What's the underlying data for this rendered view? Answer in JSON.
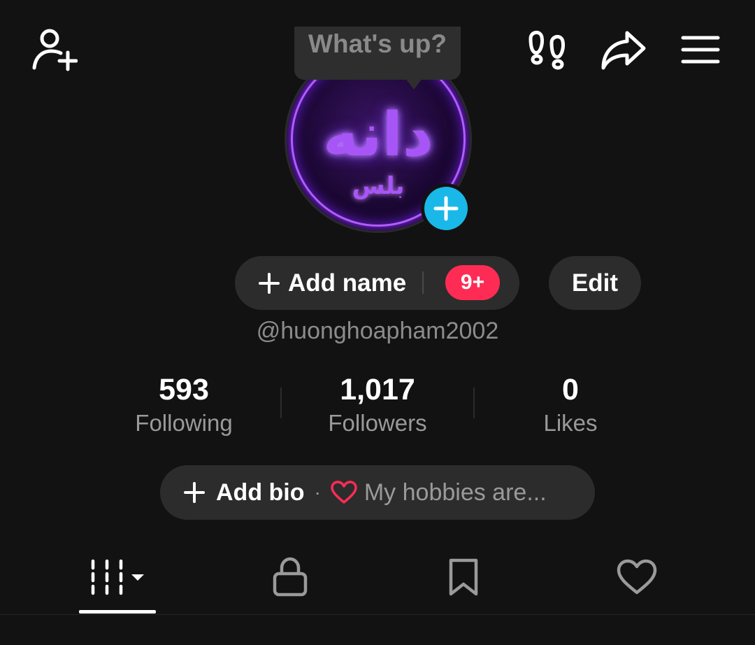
{
  "header": {
    "add_friend_icon": "person-plus-icon",
    "footprints_icon": "footprints-icon",
    "share_icon": "share-arrow-icon",
    "menu_icon": "hamburger-menu-icon"
  },
  "tooltip": {
    "text": "What's up?"
  },
  "avatar": {
    "logo_text": "دانه",
    "logo_sub": "بلس",
    "add_icon": "plus-icon",
    "add_color": "#1ab8e8"
  },
  "profile": {
    "add_name_label": "Add name",
    "badge": "9+",
    "badge_color": "#fe2c55",
    "edit_label": "Edit",
    "username": "@huonghoapham2002"
  },
  "stats": [
    {
      "value": "593",
      "label": "Following"
    },
    {
      "value": "1,017",
      "label": "Followers"
    },
    {
      "value": "0",
      "label": "Likes"
    }
  ],
  "bio": {
    "add_label": "Add bio",
    "separator": "·",
    "hint": "My hobbies are...",
    "heart_color": "#fe2c55"
  },
  "tabs": [
    {
      "icon": "videos-grid-icon",
      "selected": true
    },
    {
      "icon": "lock-icon",
      "selected": false
    },
    {
      "icon": "bookmark-icon",
      "selected": false
    },
    {
      "icon": "heart-icon",
      "selected": false
    }
  ]
}
